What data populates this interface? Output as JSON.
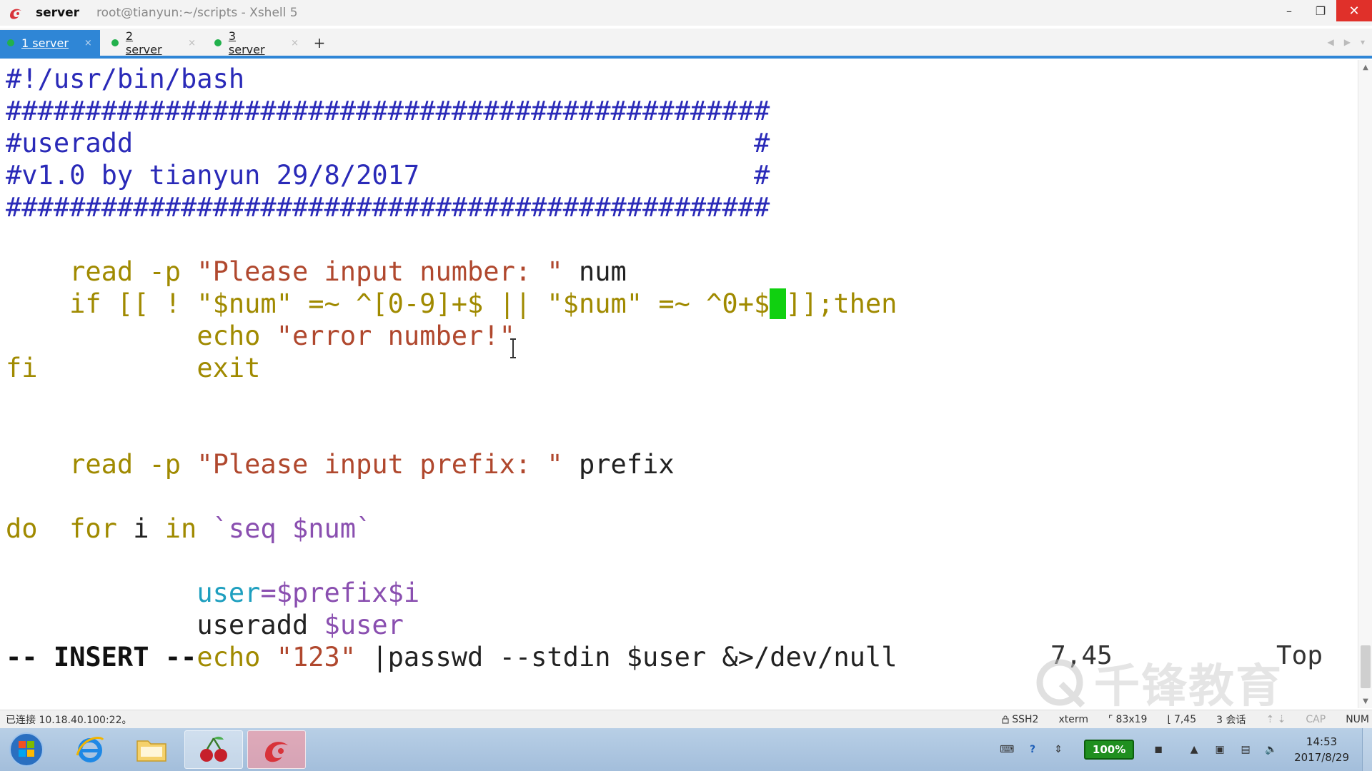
{
  "titlebar": {
    "app_name": "server",
    "subtitle": "root@tianyun:~/scripts - Xshell 5",
    "minimize": "–",
    "restore": "❐",
    "close": "✕"
  },
  "tabs": [
    {
      "label": "1 server",
      "close": "×"
    },
    {
      "label": "2 server",
      "close": "×"
    },
    {
      "label": "3 server",
      "close": "×"
    }
  ],
  "tab_add": "+",
  "tab_nav": {
    "prev": "◀",
    "next": "▶",
    "menu": "▾"
  },
  "terminal": {
    "line1": "#!/usr/bin/bash",
    "line2": "################################################",
    "line3": "#useradd                                       #",
    "line4": "#v1.0 by tianyun 29/8/2017                     #",
    "line5": "################################################",
    "line6": {
      "kw": "read",
      "opt": " -p ",
      "str": "\"Please input number: \"",
      "var": " num"
    },
    "line7": {
      "p1": "if [[ ! \"$num\" =~ ^[0-9]+$ || \"$num\" =~ ^0+$",
      "cursor": " ",
      "p2": "]];then"
    },
    "line8": {
      "indent": "        ",
      "kw": "echo",
      "str": " \"error number!\""
    },
    "line9": {
      "indent": "        ",
      "kw": "exit"
    },
    "line10": "fi",
    "line12": {
      "kw": "read",
      "opt": " -p ",
      "str": "\"Please input prefix: \"",
      "var": " prefix"
    },
    "line14": {
      "kw1": "for",
      "mid1": " i ",
      "kw2": "in",
      "tick": " `seq $num`"
    },
    "line15": "do",
    "line16": {
      "indent": "        ",
      "var": "user",
      "rest": "=$prefix$i"
    },
    "line17": {
      "indent": "        ",
      "cmd": "useradd",
      "rest": " $user"
    },
    "line18": {
      "indent": "        ",
      "kw": "echo",
      "str": " \"123\"",
      "rest": " |passwd --stdin $user &>/dev/null"
    },
    "mode": "-- INSERT --",
    "position": "7,45",
    "scroll": "Top"
  },
  "watermark": "千锋教育",
  "statusbar": {
    "connection": "已连接 10.18.40.100:22。",
    "protocol": "SSH2",
    "term": "xterm",
    "size": "83x19",
    "cursor_pos": "7,45",
    "sessions": "3 会话",
    "cap": "CAP",
    "num": "NUM"
  },
  "taskbar": {
    "battery": "100%",
    "time": "14:53",
    "date": "2017/8/29"
  }
}
